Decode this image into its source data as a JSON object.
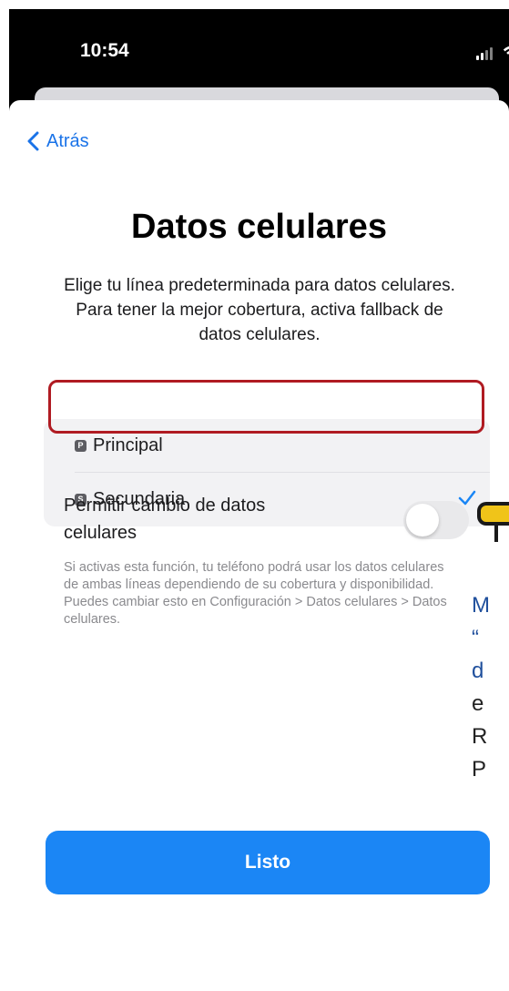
{
  "status_bar": {
    "time": "10:54"
  },
  "nav": {
    "back_label": "Atrás"
  },
  "page": {
    "title": "Datos celulares",
    "subtitle": "Elige tu línea predeterminada para datos celulares. Para tener la mejor cobertura, activa fallback de datos celulares."
  },
  "lines": [
    {
      "badge": "P",
      "label": "Principal",
      "selected": false
    },
    {
      "badge": "S",
      "label": "Secundaria",
      "selected": true
    }
  ],
  "switch": {
    "label": "Permitir cambio de datos celulares",
    "on": false,
    "description": "Si activas esta función, tu teléfono podrá usar los datos celulares de ambas líneas dependiendo de su cobertura y disponibilidad. Puedes cambiar esto en Configuración > Datos celulares > Datos celulares."
  },
  "overlay_fragments": [
    "M",
    "“",
    "d",
    "e",
    "R",
    "P"
  ],
  "colors": {
    "accent": "#1b86f5",
    "highlight_border": "#b01b22",
    "overlay_marker": "#f0c419",
    "overlay_text": "#1f4f9c"
  },
  "done_button": {
    "label": "Listo"
  }
}
